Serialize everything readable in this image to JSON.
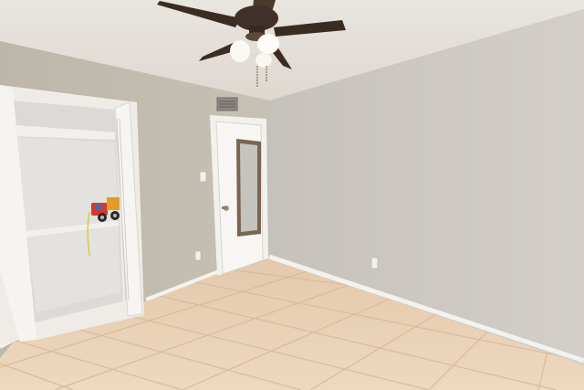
{
  "scene": {
    "subject": "empty bedroom",
    "elements": [
      "ceiling-fan",
      "closet",
      "door",
      "tile-floor",
      "light-switch",
      "outlet"
    ]
  },
  "colors": {
    "ceiling": "#e6e2dc",
    "wall_left": "#c9c3b8",
    "wall_back": "#c4beb3",
    "wall_right": "#ccc8c1",
    "floor": "#e8d0b4",
    "trim": "#f4f2ee",
    "fan_blade": "#3b2c22"
  }
}
